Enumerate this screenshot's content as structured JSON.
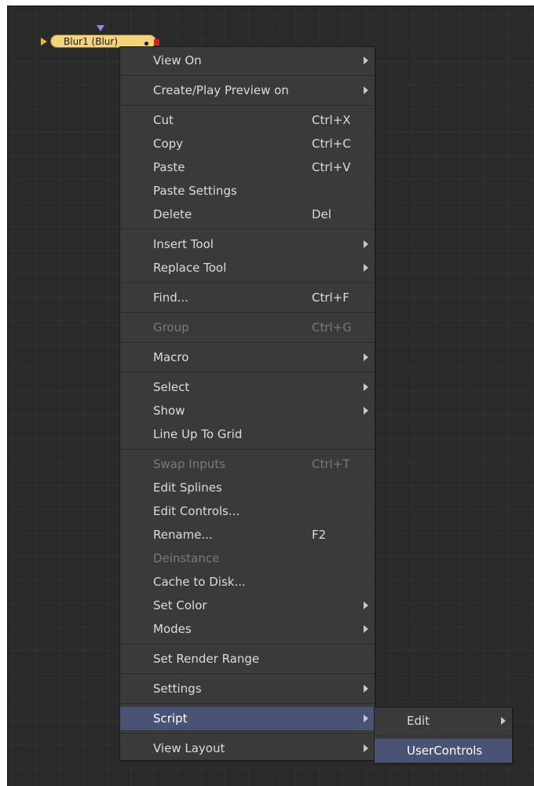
{
  "node": {
    "label": "Blur1  (Blur)",
    "colors": {
      "body": "#f3d37e",
      "input": "#e7b63a",
      "top_input": "#8d86e0",
      "output": "#d62020"
    }
  },
  "menu": {
    "items": [
      {
        "label": "View On",
        "shortcut": "",
        "submenu": true
      },
      {
        "label": "Create/Play Preview on",
        "shortcut": "",
        "submenu": true
      },
      {
        "label": "Cut",
        "shortcut": "Ctrl+X",
        "submenu": false
      },
      {
        "label": "Copy",
        "shortcut": "Ctrl+C",
        "submenu": false
      },
      {
        "label": "Paste",
        "shortcut": "Ctrl+V",
        "submenu": false
      },
      {
        "label": "Paste Settings",
        "shortcut": "",
        "submenu": false
      },
      {
        "label": "Delete",
        "shortcut": "Del",
        "submenu": false
      },
      {
        "label": "Insert Tool",
        "shortcut": "",
        "submenu": true
      },
      {
        "label": "Replace Tool",
        "shortcut": "",
        "submenu": true
      },
      {
        "label": "Find...",
        "shortcut": "Ctrl+F",
        "submenu": false
      },
      {
        "label": "Group",
        "shortcut": "Ctrl+G",
        "submenu": false,
        "disabled": true
      },
      {
        "label": "Macro",
        "shortcut": "",
        "submenu": true
      },
      {
        "label": "Select",
        "shortcut": "",
        "submenu": true
      },
      {
        "label": "Show",
        "shortcut": "",
        "submenu": true
      },
      {
        "label": "Line Up To Grid",
        "shortcut": "",
        "submenu": false
      },
      {
        "label": "Swap Inputs",
        "shortcut": "Ctrl+T",
        "submenu": false,
        "disabled": true
      },
      {
        "label": "Edit Splines",
        "shortcut": "",
        "submenu": false
      },
      {
        "label": "Edit Controls...",
        "shortcut": "",
        "submenu": false
      },
      {
        "label": "Rename...",
        "shortcut": "F2",
        "submenu": false
      },
      {
        "label": "Deinstance",
        "shortcut": "",
        "submenu": false,
        "disabled": true
      },
      {
        "label": "Cache to Disk...",
        "shortcut": "",
        "submenu": false
      },
      {
        "label": "Set Color",
        "shortcut": "",
        "submenu": true
      },
      {
        "label": "Modes",
        "shortcut": "",
        "submenu": true
      },
      {
        "label": "Set Render Range",
        "shortcut": "",
        "submenu": false
      },
      {
        "label": "Settings",
        "shortcut": "",
        "submenu": true
      },
      {
        "label": "Script",
        "shortcut": "",
        "submenu": true,
        "active": true
      },
      {
        "label": "View Layout",
        "shortcut": "",
        "submenu": true
      }
    ]
  },
  "submenu": {
    "items": [
      {
        "label": "Edit",
        "submenu": true
      },
      {
        "label": "UserControls",
        "submenu": false,
        "active": true
      }
    ]
  },
  "theme": {
    "menu_bg": "#3a3a3a",
    "highlight": "#4a5375",
    "canvas_bg": "#2a2a2a"
  }
}
